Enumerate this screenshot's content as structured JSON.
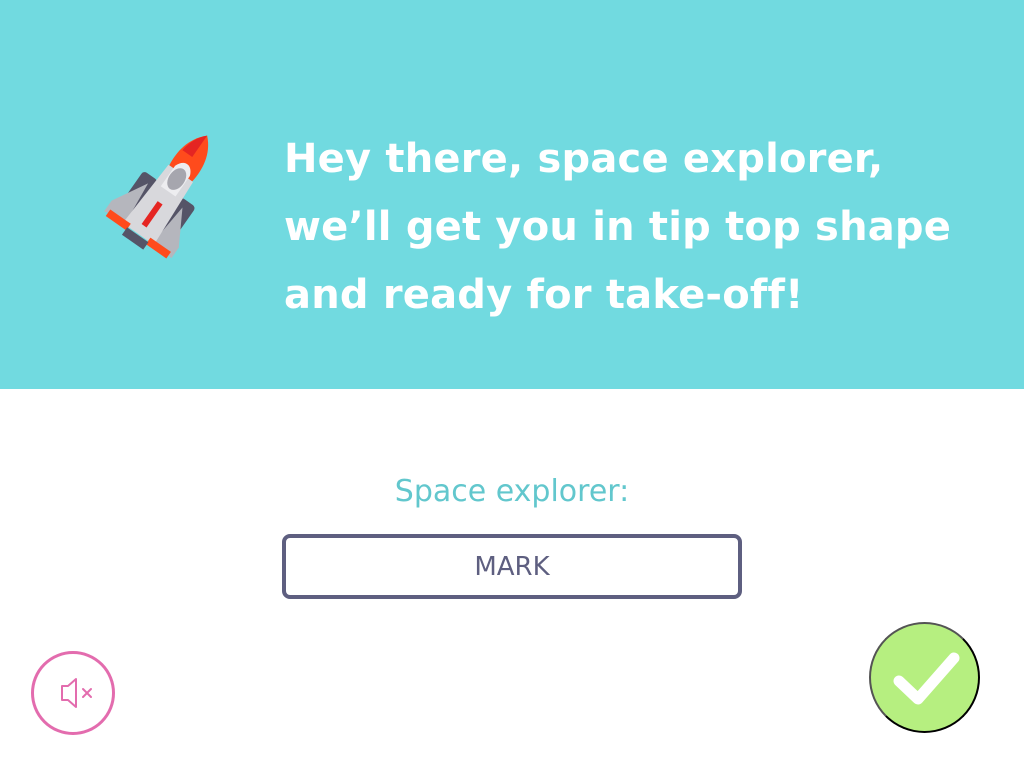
{
  "hero": {
    "background_color": "#71dae0",
    "rocket_icon": "space-shuttle-icon",
    "headline_lines": [
      "Hey there, space explorer,",
      "we’ll get you in tip top shape",
      "and ready for take-off!"
    ]
  },
  "form": {
    "label": "Space explorer:",
    "name_value": "MARK",
    "label_color": "#62c7cd",
    "field_border_color": "#5e5f80"
  },
  "controls": {
    "mute_icon": "speaker-muted-icon",
    "mute_color": "#e36cae",
    "confirm_icon": "checkmark-icon",
    "confirm_color": "#b6ef80"
  }
}
